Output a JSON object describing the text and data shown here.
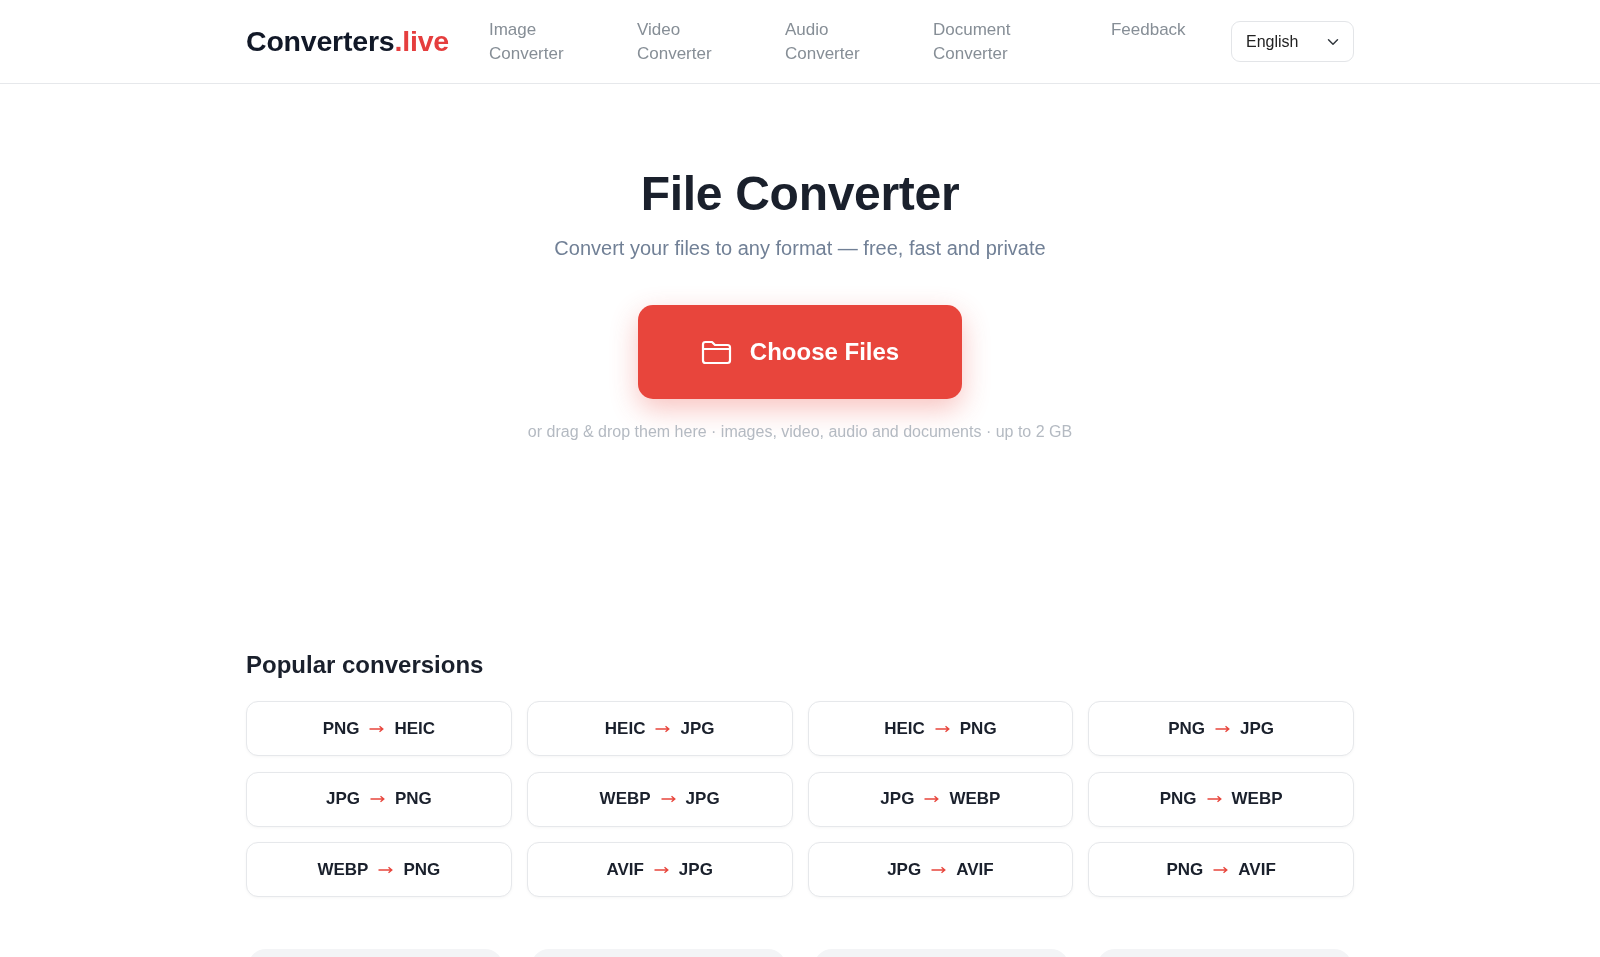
{
  "header": {
    "logo": {
      "name": "Converters",
      "accent": ".live"
    },
    "nav": [
      {
        "label": "Image Converter"
      },
      {
        "label": "Video Converter"
      },
      {
        "label": "Audio Converter"
      },
      {
        "label": "Document Converter"
      },
      {
        "label": "Feedback"
      }
    ],
    "language_select": {
      "value": "English"
    }
  },
  "hero": {
    "title": "File Converter",
    "subtitle": "Convert your files to any format — free, fast and private",
    "button": "Choose Files",
    "hint": "or drag & drop them here · images, video, audio and documents · up to 2 GB"
  },
  "popular": {
    "title": "Popular conversions",
    "items": [
      {
        "from": "PNG",
        "to": "HEIC"
      },
      {
        "from": "HEIC",
        "to": "JPG"
      },
      {
        "from": "HEIC",
        "to": "PNG"
      },
      {
        "from": "PNG",
        "to": "JPG"
      },
      {
        "from": "JPG",
        "to": "PNG"
      },
      {
        "from": "WEBP",
        "to": "JPG"
      },
      {
        "from": "JPG",
        "to": "WEBP"
      },
      {
        "from": "PNG",
        "to": "WEBP"
      },
      {
        "from": "WEBP",
        "to": "PNG"
      },
      {
        "from": "AVIF",
        "to": "JPG"
      },
      {
        "from": "JPG",
        "to": "AVIF"
      },
      {
        "from": "PNG",
        "to": "AVIF"
      }
    ]
  }
}
